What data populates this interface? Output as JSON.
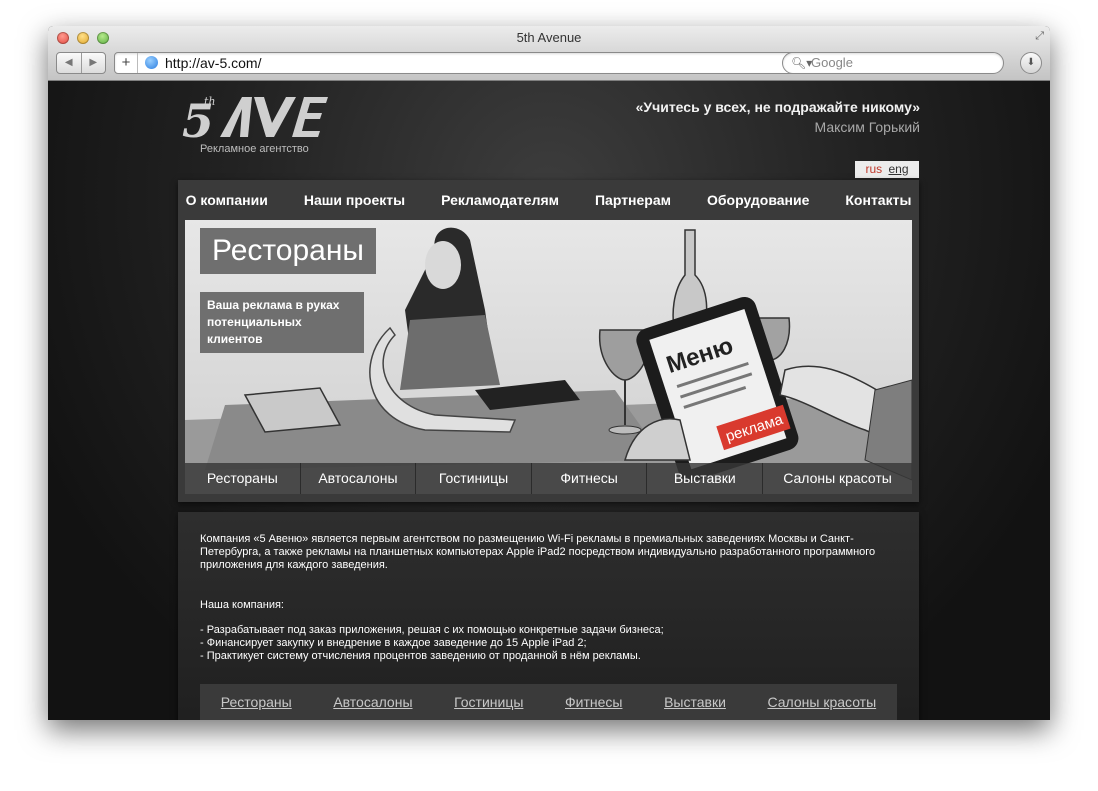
{
  "browser": {
    "title": "5th Avenue",
    "url": "http://av-5.com/",
    "search_placeholder": "Google"
  },
  "site": {
    "logo_caption": "Рекламное агентство",
    "quote": "«Учитесь у всех, не подражайте никому»",
    "quote_author": "Максим Горький",
    "lang": {
      "rus": "rus",
      "eng": "eng"
    },
    "nav": [
      "О компании",
      "Наши проекты",
      "Рекламодателям",
      "Партнерам",
      "Оборудование",
      "Контакты"
    ],
    "banner": {
      "title": "Рестораны",
      "subtitle": "Ваша реклама в руках потенциальных клиентов",
      "tablet_title": "Меню",
      "tablet_tag": "реклама"
    },
    "categories": [
      "Рестораны",
      "Автосалоны",
      "Гостиницы",
      "Фитнесы",
      "Выставки",
      "Салоны красоты"
    ],
    "about": {
      "text": "Компания «5 Авеню» является первым агентством по размещению Wi-Fi рекламы в премиальных заведениях Москвы и Санкт-Петербурга, а также рекламы на планшетных компьютерах Apple iPad2 посредством индивидуально разработанного программного приложения для каждого заведения.",
      "heading": "Наша компания:",
      "items": [
        "- Разрабатывает под заказ приложения, решая с их помощью конкретные задачи бизнеса;",
        "- Финансирует закупку и внедрение в каждое заведение до 15 Apple iPad 2;",
        "- Практикует систему отчисления процентов заведению от проданной в нём рекламы."
      ]
    }
  }
}
